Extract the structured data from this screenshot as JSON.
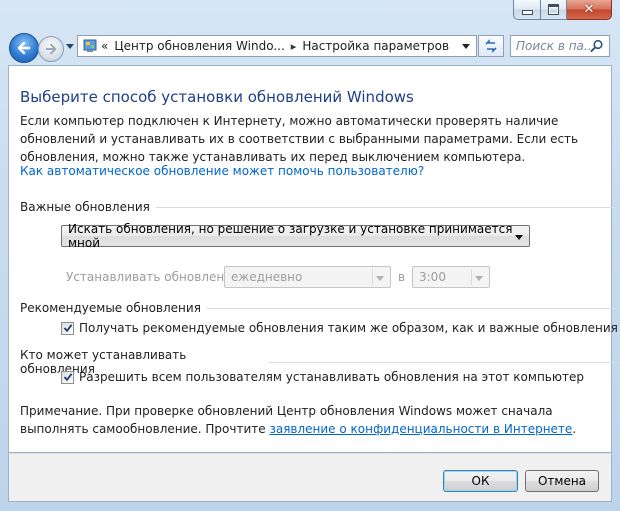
{
  "window": {
    "minimize_icon": "minimize-icon",
    "maximize_icon": "maximize-icon",
    "close_icon": "close-icon"
  },
  "nav": {
    "address_prefix": "«",
    "segment_1": "Центр обновления Windo...",
    "segment_2": "Настройка параметров",
    "search_placeholder": "Поиск в па..."
  },
  "content": {
    "title": "Выберите способ установки обновлений Windows",
    "description": "Если компьютер подключен к Интернету, можно автоматически проверять наличие обновлений и устанавливать их в соответствии с выбранными параметрами. Если есть обновления, можно также устанавливать их перед выключением компьютера.",
    "help_link": "Как автоматическое обновление может помочь пользователю?",
    "important": {
      "heading": "Важные обновления",
      "selected": "Искать обновления, но решение о загрузке и установке принимается мной",
      "install_label": "Устанавливать обновления:",
      "day_value": "ежедневно",
      "at_label": "в",
      "time_value": "3:00"
    },
    "recommended": {
      "heading": "Рекомендуемые обновления",
      "checkbox_label": "Получать рекомендуемые обновления таким же образом, как и важные обновления",
      "checked": true
    },
    "who": {
      "heading": "Кто может устанавливать обновления",
      "checkbox_label": "Разрешить всем пользователям устанавливать обновления на этот компьютер",
      "checked": true
    },
    "note_text": "Примечание. При проверке обновлений Центр обновления Windows может сначала выполнять самообновление. Прочтите ",
    "note_link": "заявление о конфиденциальности в Интернете",
    "note_end": "."
  },
  "footer": {
    "ok_label": "ОК",
    "cancel_label": "Отмена"
  },
  "colors": {
    "title": "#1e3f8a",
    "link": "#0066cc"
  }
}
